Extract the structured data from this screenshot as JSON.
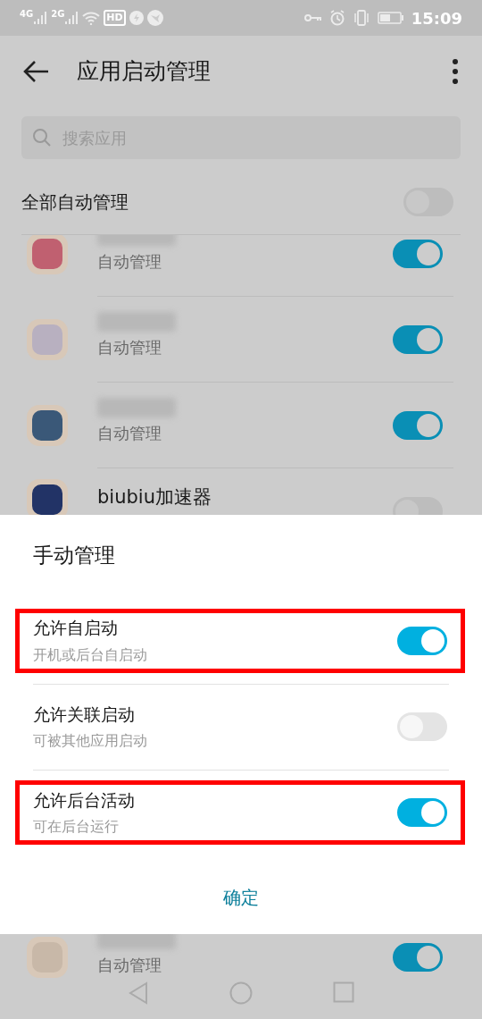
{
  "status_bar": {
    "network_1": "4G",
    "network_2": "2G",
    "hd": "HD",
    "time": "15:09"
  },
  "header": {
    "title": "应用启动管理"
  },
  "search": {
    "placeholder": "搜索应用"
  },
  "auto_all": {
    "label": "全部自动管理",
    "on": false
  },
  "apps": [
    {
      "subtitle": "自动管理",
      "on": true
    },
    {
      "subtitle": "自动管理",
      "on": true
    },
    {
      "subtitle": "自动管理",
      "on": true
    },
    {
      "name": "biubiu加速器",
      "on": false
    },
    {
      "subtitle": "自动管理",
      "on": true
    }
  ],
  "sheet": {
    "title": "手动管理",
    "options": [
      {
        "label": "允许自启动",
        "description": "开机或后台自启动",
        "on": true,
        "highlighted": true
      },
      {
        "label": "允许关联启动",
        "description": "可被其他应用启动",
        "on": false,
        "highlighted": false
      },
      {
        "label": "允许后台活动",
        "description": "可在后台运行",
        "on": true,
        "highlighted": true
      }
    ],
    "confirm": "确定"
  }
}
